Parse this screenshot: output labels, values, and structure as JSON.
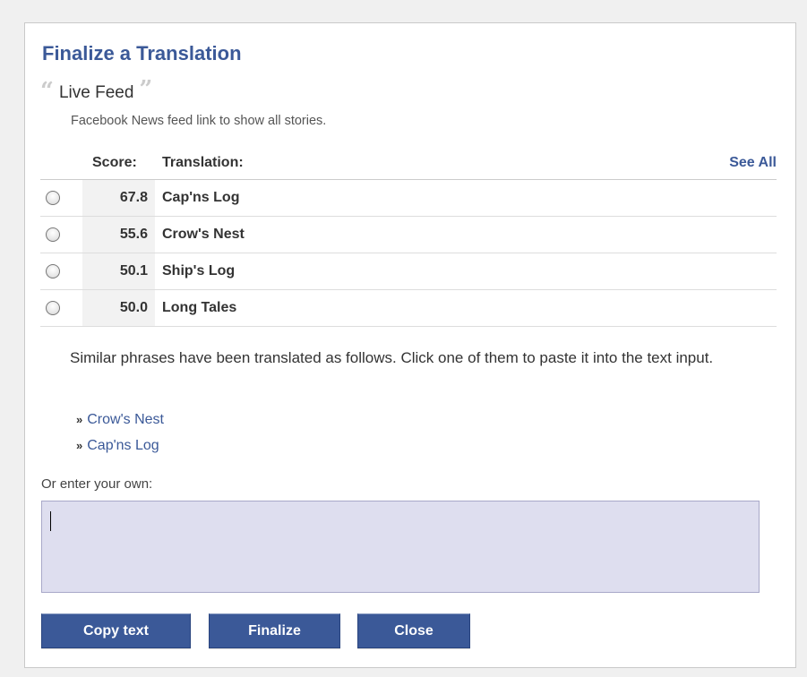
{
  "dialog": {
    "title": "Finalize a Translation",
    "phrase": {
      "open_quote": "“",
      "text": "Live Feed",
      "close_quote": "”",
      "description": "Facebook News feed link to show all stories."
    },
    "table": {
      "score_header": "Score:",
      "translation_header": "Translation:",
      "see_all": "See All",
      "rows": [
        {
          "score": "67.8",
          "translation": "Cap'ns Log"
        },
        {
          "score": "55.6",
          "translation": "Crow's Nest"
        },
        {
          "score": "50.1",
          "translation": "Ship's Log"
        },
        {
          "score": "50.0",
          "translation": "Long Tales"
        }
      ]
    },
    "similar_text": "Similar phrases have been translated as follows. Click one of them to paste it into the text input.",
    "suggestion_bullet": "»",
    "suggestions": [
      "Crow's Nest",
      "Cap'ns Log"
    ],
    "own_label": "Or enter your own:",
    "own_input_value": "",
    "buttons": {
      "copy": "Copy text",
      "finalize": "Finalize",
      "close": "Close"
    }
  },
  "colors": {
    "accent": "#3b5998",
    "input_bg": "#dedeef",
    "score_bg": "#f2f2f2"
  }
}
